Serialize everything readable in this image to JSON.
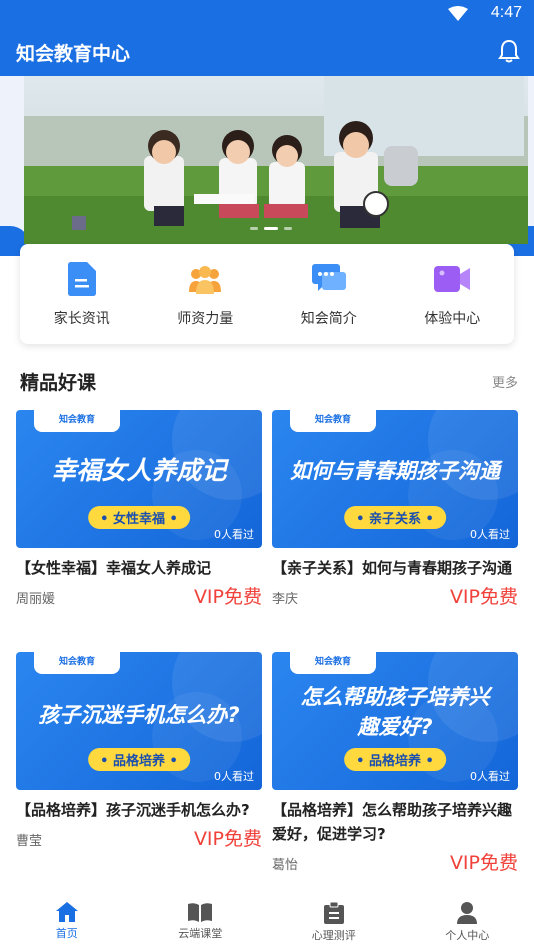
{
  "status": {
    "time": "4:47"
  },
  "app": {
    "title": "知会教育中心"
  },
  "quick_links": [
    {
      "label": "家长资讯",
      "icon": "document-icon"
    },
    {
      "label": "师资力量",
      "icon": "team-icon"
    },
    {
      "label": "知会简介",
      "icon": "chat-icon"
    },
    {
      "label": "体验中心",
      "icon": "video-icon"
    }
  ],
  "section": {
    "title": "精品好课",
    "more": "更多"
  },
  "courses": [
    {
      "logo": "知会教育",
      "big": "幸福女人养成记",
      "tag": "• 女性幸福 •",
      "views": "0人看过",
      "title": "【女性幸福】幸福女人养成记",
      "author": "周丽媛",
      "price": "VIP免费"
    },
    {
      "logo": "知会教育",
      "big": "如何与青春期孩子沟通",
      "tag": "• 亲子关系 •",
      "views": "0人看过",
      "title": "【亲子关系】如何与青春期孩子沟通",
      "author": "李庆",
      "price": "VIP免费"
    },
    {
      "logo": "知会教育",
      "big": "孩子沉迷手机怎么办?",
      "tag": "• 品格培养 •",
      "views": "0人看过",
      "title": "【品格培养】孩子沉迷手机怎么办?",
      "author": "曹莹",
      "price": "VIP免费"
    },
    {
      "logo": "知会教育",
      "big": "怎么帮助孩子培养兴趣爱好?",
      "tag": "• 品格培养 •",
      "views": "0人看过",
      "title": "【品格培养】怎么帮助孩子培养兴趣爱好，促进学习?",
      "author": "葛怡",
      "price": "VIP免费"
    }
  ],
  "nav": [
    {
      "label": "首页",
      "icon": "home-icon",
      "active": true
    },
    {
      "label": "云端课堂",
      "icon": "book-icon"
    },
    {
      "label": "心理测评",
      "icon": "clipboard-icon"
    },
    {
      "label": "个人中心",
      "icon": "person-icon"
    }
  ],
  "colors": {
    "primary": "#1a6fe3",
    "price": "#f0423b",
    "tag": "#ffd93d"
  }
}
